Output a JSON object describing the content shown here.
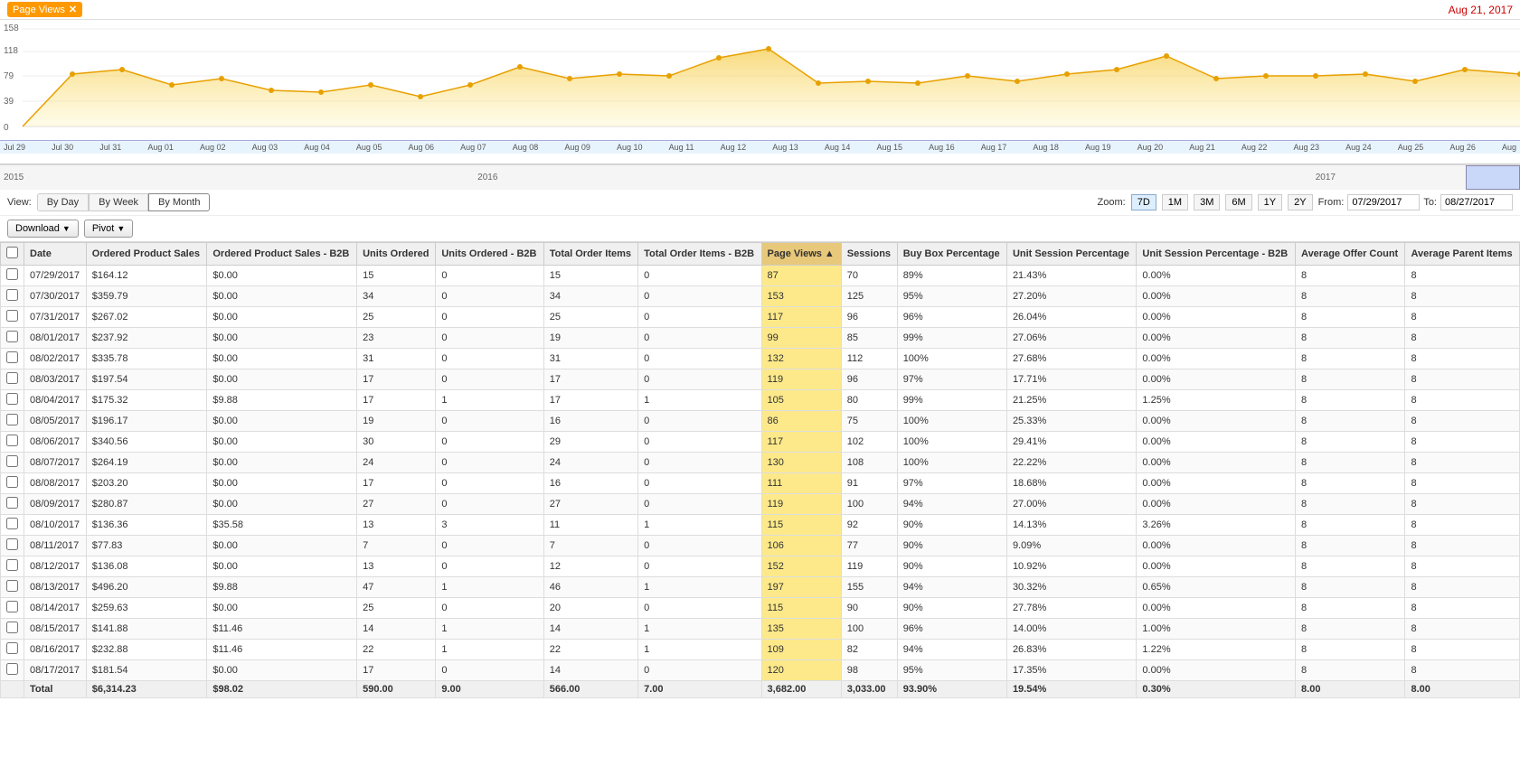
{
  "topbar": {
    "tag_label": "Page Views",
    "date_label": "Aug 21, 2017"
  },
  "chart": {
    "y_labels": [
      "158",
      "118",
      "79",
      "39",
      "0"
    ],
    "x_labels": [
      "Jul 29",
      "Jul 30",
      "Jul 31",
      "Aug 01",
      "Aug 02",
      "Aug 03",
      "Aug 04",
      "Aug 05",
      "Aug 06",
      "Aug 07",
      "Aug 08",
      "Aug 09",
      "Aug 10",
      "Aug 11",
      "Aug 12",
      "Aug 13",
      "Aug 14",
      "Aug 15",
      "Aug 16",
      "Aug 17",
      "Aug 18",
      "Aug 19",
      "Aug 20",
      "Aug 21",
      "Aug 22",
      "Aug 23",
      "Aug 24",
      "Aug 25",
      "Aug 26",
      "Aug"
    ]
  },
  "nav": {
    "years": [
      "2015",
      "2016",
      "2017"
    ]
  },
  "view_controls": {
    "view_label": "View:",
    "by_day": "By Day",
    "by_week": "By Week",
    "by_month": "By Month",
    "zoom_label": "Zoom:",
    "zoom_options": [
      "7D",
      "1M",
      "3M",
      "6M",
      "1Y",
      "2Y"
    ],
    "active_zoom": "7D",
    "from_label": "From:",
    "from_value": "07/29/2017",
    "to_label": "To:",
    "to_value": "08/27/2017"
  },
  "toolbar": {
    "download_label": "Download",
    "pivot_label": "Pivot"
  },
  "table": {
    "columns": [
      {
        "key": "checkbox",
        "label": ""
      },
      {
        "key": "date",
        "label": "Date"
      },
      {
        "key": "ordered_product_sales",
        "label": "Ordered Product Sales"
      },
      {
        "key": "ordered_product_sales_b2b",
        "label": "Ordered Product Sales - B2B"
      },
      {
        "key": "units_ordered",
        "label": "Units Ordered"
      },
      {
        "key": "units_ordered_b2b",
        "label": "Units Ordered - B2B"
      },
      {
        "key": "total_order_items",
        "label": "Total Order Items"
      },
      {
        "key": "total_order_items_b2b",
        "label": "Total Order Items - B2B"
      },
      {
        "key": "page_views",
        "label": "Page Views"
      },
      {
        "key": "sessions",
        "label": "Sessions"
      },
      {
        "key": "buy_box_pct",
        "label": "Buy Box Percentage"
      },
      {
        "key": "unit_session_pct",
        "label": "Unit Session Percentage"
      },
      {
        "key": "unit_session_pct_b2b",
        "label": "Unit Session Percentage - B2B"
      },
      {
        "key": "avg_offer_count",
        "label": "Average Offer Count"
      },
      {
        "key": "avg_parent_items",
        "label": "Average Parent Items"
      }
    ],
    "rows": [
      {
        "date": "07/29/2017",
        "ordered_product_sales": "$164.12",
        "ordered_product_sales_b2b": "$0.00",
        "units_ordered": "15",
        "units_ordered_b2b": "0",
        "total_order_items": "15",
        "total_order_items_b2b": "0",
        "page_views": "87",
        "sessions": "70",
        "buy_box_pct": "89%",
        "unit_session_pct": "21.43%",
        "unit_session_pct_b2b": "0.00%",
        "avg_offer_count": "8",
        "avg_parent_items": "8"
      },
      {
        "date": "07/30/2017",
        "ordered_product_sales": "$359.79",
        "ordered_product_sales_b2b": "$0.00",
        "units_ordered": "34",
        "units_ordered_b2b": "0",
        "total_order_items": "34",
        "total_order_items_b2b": "0",
        "page_views": "153",
        "sessions": "125",
        "buy_box_pct": "95%",
        "unit_session_pct": "27.20%",
        "unit_session_pct_b2b": "0.00%",
        "avg_offer_count": "8",
        "avg_parent_items": "8"
      },
      {
        "date": "07/31/2017",
        "ordered_product_sales": "$267.02",
        "ordered_product_sales_b2b": "$0.00",
        "units_ordered": "25",
        "units_ordered_b2b": "0",
        "total_order_items": "25",
        "total_order_items_b2b": "0",
        "page_views": "117",
        "sessions": "96",
        "buy_box_pct": "96%",
        "unit_session_pct": "26.04%",
        "unit_session_pct_b2b": "0.00%",
        "avg_offer_count": "8",
        "avg_parent_items": "8"
      },
      {
        "date": "08/01/2017",
        "ordered_product_sales": "$237.92",
        "ordered_product_sales_b2b": "$0.00",
        "units_ordered": "23",
        "units_ordered_b2b": "0",
        "total_order_items": "19",
        "total_order_items_b2b": "0",
        "page_views": "99",
        "sessions": "85",
        "buy_box_pct": "99%",
        "unit_session_pct": "27.06%",
        "unit_session_pct_b2b": "0.00%",
        "avg_offer_count": "8",
        "avg_parent_items": "8"
      },
      {
        "date": "08/02/2017",
        "ordered_product_sales": "$335.78",
        "ordered_product_sales_b2b": "$0.00",
        "units_ordered": "31",
        "units_ordered_b2b": "0",
        "total_order_items": "31",
        "total_order_items_b2b": "0",
        "page_views": "132",
        "sessions": "112",
        "buy_box_pct": "100%",
        "unit_session_pct": "27.68%",
        "unit_session_pct_b2b": "0.00%",
        "avg_offer_count": "8",
        "avg_parent_items": "8"
      },
      {
        "date": "08/03/2017",
        "ordered_product_sales": "$197.54",
        "ordered_product_sales_b2b": "$0.00",
        "units_ordered": "17",
        "units_ordered_b2b": "0",
        "total_order_items": "17",
        "total_order_items_b2b": "0",
        "page_views": "119",
        "sessions": "96",
        "buy_box_pct": "97%",
        "unit_session_pct": "17.71%",
        "unit_session_pct_b2b": "0.00%",
        "avg_offer_count": "8",
        "avg_parent_items": "8"
      },
      {
        "date": "08/04/2017",
        "ordered_product_sales": "$175.32",
        "ordered_product_sales_b2b": "$9.88",
        "units_ordered": "17",
        "units_ordered_b2b": "1",
        "total_order_items": "17",
        "total_order_items_b2b": "1",
        "page_views": "105",
        "sessions": "80",
        "buy_box_pct": "99%",
        "unit_session_pct": "21.25%",
        "unit_session_pct_b2b": "1.25%",
        "avg_offer_count": "8",
        "avg_parent_items": "8"
      },
      {
        "date": "08/05/2017",
        "ordered_product_sales": "$196.17",
        "ordered_product_sales_b2b": "$0.00",
        "units_ordered": "19",
        "units_ordered_b2b": "0",
        "total_order_items": "16",
        "total_order_items_b2b": "0",
        "page_views": "86",
        "sessions": "75",
        "buy_box_pct": "100%",
        "unit_session_pct": "25.33%",
        "unit_session_pct_b2b": "0.00%",
        "avg_offer_count": "8",
        "avg_parent_items": "8"
      },
      {
        "date": "08/06/2017",
        "ordered_product_sales": "$340.56",
        "ordered_product_sales_b2b": "$0.00",
        "units_ordered": "30",
        "units_ordered_b2b": "0",
        "total_order_items": "29",
        "total_order_items_b2b": "0",
        "page_views": "117",
        "sessions": "102",
        "buy_box_pct": "100%",
        "unit_session_pct": "29.41%",
        "unit_session_pct_b2b": "0.00%",
        "avg_offer_count": "8",
        "avg_parent_items": "8"
      },
      {
        "date": "08/07/2017",
        "ordered_product_sales": "$264.19",
        "ordered_product_sales_b2b": "$0.00",
        "units_ordered": "24",
        "units_ordered_b2b": "0",
        "total_order_items": "24",
        "total_order_items_b2b": "0",
        "page_views": "130",
        "sessions": "108",
        "buy_box_pct": "100%",
        "unit_session_pct": "22.22%",
        "unit_session_pct_b2b": "0.00%",
        "avg_offer_count": "8",
        "avg_parent_items": "8"
      },
      {
        "date": "08/08/2017",
        "ordered_product_sales": "$203.20",
        "ordered_product_sales_b2b": "$0.00",
        "units_ordered": "17",
        "units_ordered_b2b": "0",
        "total_order_items": "16",
        "total_order_items_b2b": "0",
        "page_views": "111",
        "sessions": "91",
        "buy_box_pct": "97%",
        "unit_session_pct": "18.68%",
        "unit_session_pct_b2b": "0.00%",
        "avg_offer_count": "8",
        "avg_parent_items": "8"
      },
      {
        "date": "08/09/2017",
        "ordered_product_sales": "$280.87",
        "ordered_product_sales_b2b": "$0.00",
        "units_ordered": "27",
        "units_ordered_b2b": "0",
        "total_order_items": "27",
        "total_order_items_b2b": "0",
        "page_views": "119",
        "sessions": "100",
        "buy_box_pct": "94%",
        "unit_session_pct": "27.00%",
        "unit_session_pct_b2b": "0.00%",
        "avg_offer_count": "8",
        "avg_parent_items": "8"
      },
      {
        "date": "08/10/2017",
        "ordered_product_sales": "$136.36",
        "ordered_product_sales_b2b": "$35.58",
        "units_ordered": "13",
        "units_ordered_b2b": "3",
        "total_order_items": "11",
        "total_order_items_b2b": "1",
        "page_views": "115",
        "sessions": "92",
        "buy_box_pct": "90%",
        "unit_session_pct": "14.13%",
        "unit_session_pct_b2b": "3.26%",
        "avg_offer_count": "8",
        "avg_parent_items": "8"
      },
      {
        "date": "08/11/2017",
        "ordered_product_sales": "$77.83",
        "ordered_product_sales_b2b": "$0.00",
        "units_ordered": "7",
        "units_ordered_b2b": "0",
        "total_order_items": "7",
        "total_order_items_b2b": "0",
        "page_views": "106",
        "sessions": "77",
        "buy_box_pct": "90%",
        "unit_session_pct": "9.09%",
        "unit_session_pct_b2b": "0.00%",
        "avg_offer_count": "8",
        "avg_parent_items": "8"
      },
      {
        "date": "08/12/2017",
        "ordered_product_sales": "$136.08",
        "ordered_product_sales_b2b": "$0.00",
        "units_ordered": "13",
        "units_ordered_b2b": "0",
        "total_order_items": "12",
        "total_order_items_b2b": "0",
        "page_views": "152",
        "sessions": "119",
        "buy_box_pct": "90%",
        "unit_session_pct": "10.92%",
        "unit_session_pct_b2b": "0.00%",
        "avg_offer_count": "8",
        "avg_parent_items": "8"
      },
      {
        "date": "08/13/2017",
        "ordered_product_sales": "$496.20",
        "ordered_product_sales_b2b": "$9.88",
        "units_ordered": "47",
        "units_ordered_b2b": "1",
        "total_order_items": "46",
        "total_order_items_b2b": "1",
        "page_views": "197",
        "sessions": "155",
        "buy_box_pct": "94%",
        "unit_session_pct": "30.32%",
        "unit_session_pct_b2b": "0.65%",
        "avg_offer_count": "8",
        "avg_parent_items": "8"
      },
      {
        "date": "08/14/2017",
        "ordered_product_sales": "$259.63",
        "ordered_product_sales_b2b": "$0.00",
        "units_ordered": "25",
        "units_ordered_b2b": "0",
        "total_order_items": "20",
        "total_order_items_b2b": "0",
        "page_views": "115",
        "sessions": "90",
        "buy_box_pct": "90%",
        "unit_session_pct": "27.78%",
        "unit_session_pct_b2b": "0.00%",
        "avg_offer_count": "8",
        "avg_parent_items": "8"
      },
      {
        "date": "08/15/2017",
        "ordered_product_sales": "$141.88",
        "ordered_product_sales_b2b": "$11.46",
        "units_ordered": "14",
        "units_ordered_b2b": "1",
        "total_order_items": "14",
        "total_order_items_b2b": "1",
        "page_views": "135",
        "sessions": "100",
        "buy_box_pct": "96%",
        "unit_session_pct": "14.00%",
        "unit_session_pct_b2b": "1.00%",
        "avg_offer_count": "8",
        "avg_parent_items": "8"
      },
      {
        "date": "08/16/2017",
        "ordered_product_sales": "$232.88",
        "ordered_product_sales_b2b": "$11.46",
        "units_ordered": "22",
        "units_ordered_b2b": "1",
        "total_order_items": "22",
        "total_order_items_b2b": "1",
        "page_views": "109",
        "sessions": "82",
        "buy_box_pct": "94%",
        "unit_session_pct": "26.83%",
        "unit_session_pct_b2b": "1.22%",
        "avg_offer_count": "8",
        "avg_parent_items": "8"
      },
      {
        "date": "08/17/2017",
        "ordered_product_sales": "$181.54",
        "ordered_product_sales_b2b": "$0.00",
        "units_ordered": "17",
        "units_ordered_b2b": "0",
        "total_order_items": "14",
        "total_order_items_b2b": "0",
        "page_views": "120",
        "sessions": "98",
        "buy_box_pct": "95%",
        "unit_session_pct": "17.35%",
        "unit_session_pct_b2b": "0.00%",
        "avg_offer_count": "8",
        "avg_parent_items": "8"
      }
    ],
    "total_row": {
      "label": "Total",
      "ordered_product_sales": "$6,314.23",
      "ordered_product_sales_b2b": "$98.02",
      "units_ordered": "590.00",
      "units_ordered_b2b": "9.00",
      "total_order_items": "566.00",
      "total_order_items_b2b": "7.00",
      "page_views": "3,682.00",
      "sessions": "3,033.00",
      "buy_box_pct": "93.90%",
      "unit_session_pct": "19.54%",
      "unit_session_pct_b2b": "0.30%",
      "avg_offer_count": "8.00",
      "avg_parent_items": "8.00"
    }
  }
}
